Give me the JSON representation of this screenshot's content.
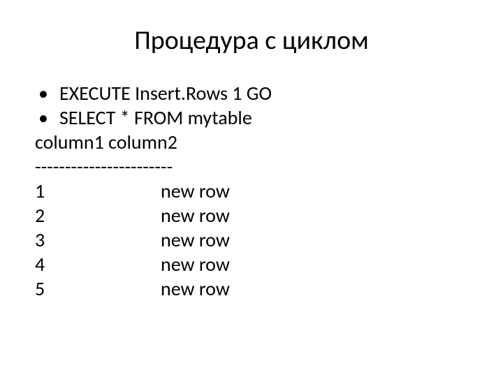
{
  "title": "Процедура с циклом",
  "bullets": [
    "EXECUTE Insert.Rows 1 GO",
    "SELECT * FROM mytable"
  ],
  "header_line": "column1 column2",
  "divider": "-----------------------",
  "rows": [
    {
      "c1": "1",
      "c2": "new row"
    },
    {
      "c1": "2",
      "c2": "new row"
    },
    {
      "c1": "3",
      "c2": "new row"
    },
    {
      "c1": "4",
      "c2": "new row"
    },
    {
      "c1": "5",
      "c2": "new row"
    }
  ]
}
